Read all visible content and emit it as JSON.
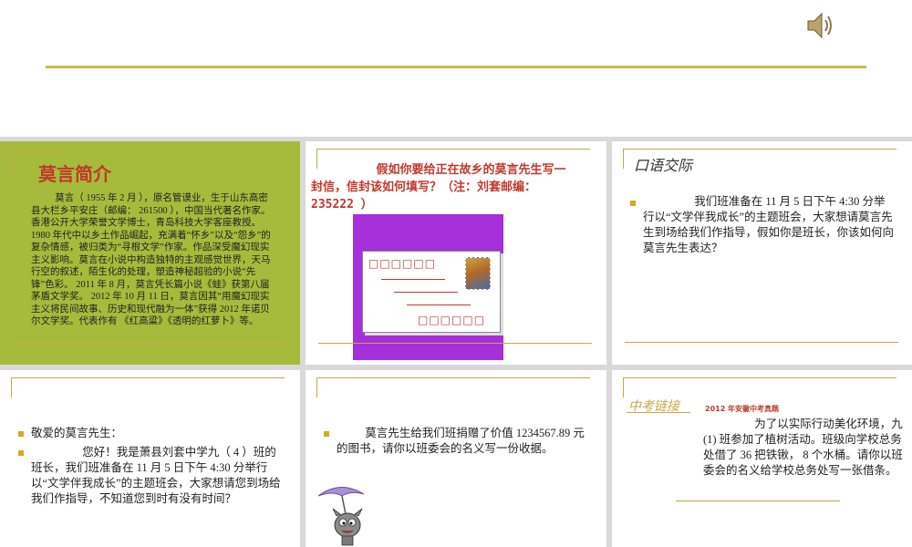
{
  "panels": {
    "intro": {
      "title": "莫言简介",
      "body": "莫言（ 1955 年 2 月 ），原名管谟业，生于山东高密县大栏乡平安庄（邮编： 261500 ），中国当代著名作家。香港公开大学荣誉文学博士，青岛科技大学客座教授。 1980 年代中以乡土作品崛起，充满着“怀乡”以及“怨乡”的复杂情感，被归类为“寻根文学”作家。作品深受魔幻现实主义影响。莫言在小说中构造独特的主观感觉世界，天马行空的叙述，陌生化的处理，塑造神秘超验的小说“先锋”色彩。 2011 年 8 月，莫言凭长篇小说《蛙》获第八届茅盾文学奖。 2012 年 10 月 11 日，莫言因其“用魔幻现实主义将民间故事、历史和现代融为一体”获得 2012 年诺贝尔文学奖。代表作有 《红高粱》《透明的红萝卜》等。"
    },
    "letter": {
      "question": "假如你要给正在故乡的莫言先生写一封信，信封该如何填写？（注：刘套邮编： 235222 ）",
      "top_boxes": "□□□□□□",
      "bottom_boxes": "□□□□□□"
    },
    "oral": {
      "title": "口语交际",
      "text": "我们班准备在 11 月 5 日下午 4:30 分举行以“文学伴我成长”的主题班会，大家想请莫言先生到场给我们作指导，假如你是班长，你该如何向莫言先生表达？"
    },
    "greeting": {
      "line1": "敬爱的莫言先生：",
      "line2": "您好！我是萧县刘套中学九（ 4 ）班的班长，我们班准备在 11 月 5 日下午 4:30 分举行以“文学伴我成长”的主题班会，大家想请您到场给我们作指导，不知道您到时有没有时间？"
    },
    "receipt": {
      "text": "莫言先生给我们班捐赠了价值 1234567.89 元的图书，请你以班委会的名义写一份收据。"
    },
    "exam": {
      "label": "中考链接",
      "source": "2012 年安徽中考真题",
      "text": "为了以实际行动美化环境，九 (1) 班参加了植树活动。班级向学校总务处借了 36 把铁锹， 8 个水桶。请你以班委会的名义给学校总务处写一张借条。"
    }
  },
  "colors": {
    "accent_gold": "#d4b64a",
    "intro_bg": "#a6bb3c",
    "title_red": "#c0392b",
    "envelope_bg": "#a52fd9"
  }
}
